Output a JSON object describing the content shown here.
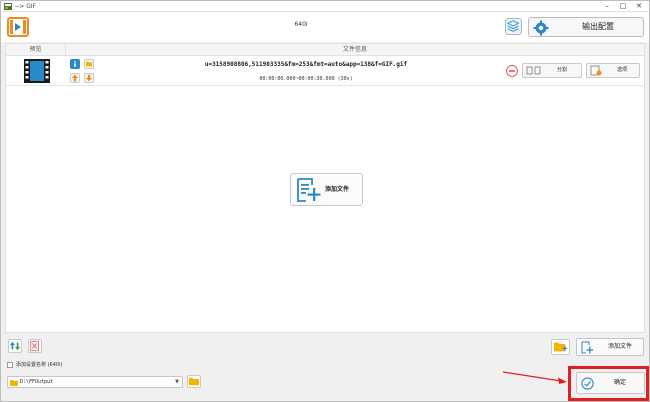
{
  "window": {
    "title": "--> GIF",
    "controls": {
      "minimize": "–",
      "maximize": "□",
      "close": "✕"
    }
  },
  "toolbar": {
    "preset_name": "640i",
    "output_config_label": "输出配置",
    "icons": {
      "logo": "video-play-logo-icon",
      "layers": "layers-icon",
      "gear": "gear-icon"
    }
  },
  "file_list": {
    "headers": {
      "preview": "预览",
      "file_info": "文件信息"
    },
    "rows": [
      {
        "filename": "u=3158908806,511903335&fm=253&fmt=auto&app=138&f=GIF.gif",
        "time_range": "00:00:00.000~00:00:30.000 (30s)",
        "split_label": "分割",
        "options_label": "选项"
      }
    ],
    "center_add_label": "添加文件"
  },
  "bottom": {
    "add_preset_name_label": "添加设置名称 (640i)",
    "add_preset_name_checked": false,
    "output_path": "D:\\FFOutput",
    "add_file_label": "添加文件",
    "confirm_label": "确定"
  },
  "colors": {
    "accent_blue": "#2a8ac8",
    "highlight_red": "#e02020",
    "logo_orange": "#f08a1c"
  }
}
